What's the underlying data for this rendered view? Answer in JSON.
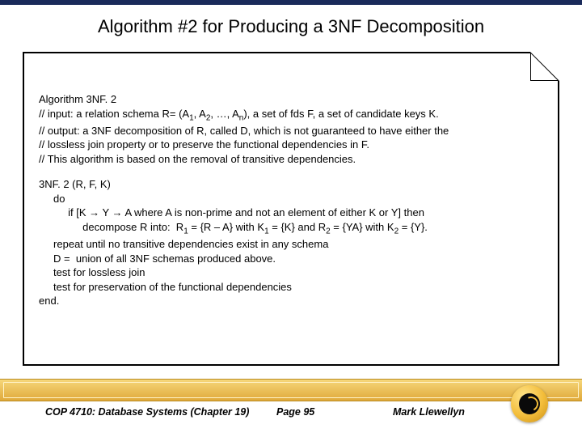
{
  "title": "Algorithm #2 for Producing a 3NF Decomposition",
  "algo": {
    "l1": "Algorithm 3NF. 2",
    "l2a": "// input: a relation schema R= (A",
    "l2b": ", A",
    "l2c": ", …, A",
    "l2d": "),   a set of fds F, a set of candidate keys K.",
    "l3": "// output:  a 3NF decomposition of R, called D, which is not guaranteed to have either the",
    "l4": "//                lossless join property or to preserve the functional dependencies in F.",
    "l5": "//  This algorithm is based on the removal of transitive dependencies."
  },
  "body": {
    "b1": "3NF. 2 (R, F, K)",
    "b2": "     do",
    "b3": "          if [K → Y → A where A is non-prime and not an element of either K or Y] then",
    "b4a": "               decompose R into:  R",
    "b4b": " = {R – A} with K",
    "b4c": " = {K} and R",
    "b4d": " = {YA} with K",
    "b4e": " = {Y}.",
    "b5": "     repeat until no transitive dependencies exist in any schema",
    "b6": "     D =  union of all 3NF schemas produced above.",
    "b7": "     test for lossless join",
    "b8": "     test for preservation of the functional dependencies",
    "b9": "end."
  },
  "footer": {
    "left": "COP 4710: Database Systems  (Chapter 19)",
    "center": "Page 95",
    "right": "Mark Llewellyn"
  },
  "sub": {
    "one": "1",
    "two": "2",
    "n": "n"
  }
}
